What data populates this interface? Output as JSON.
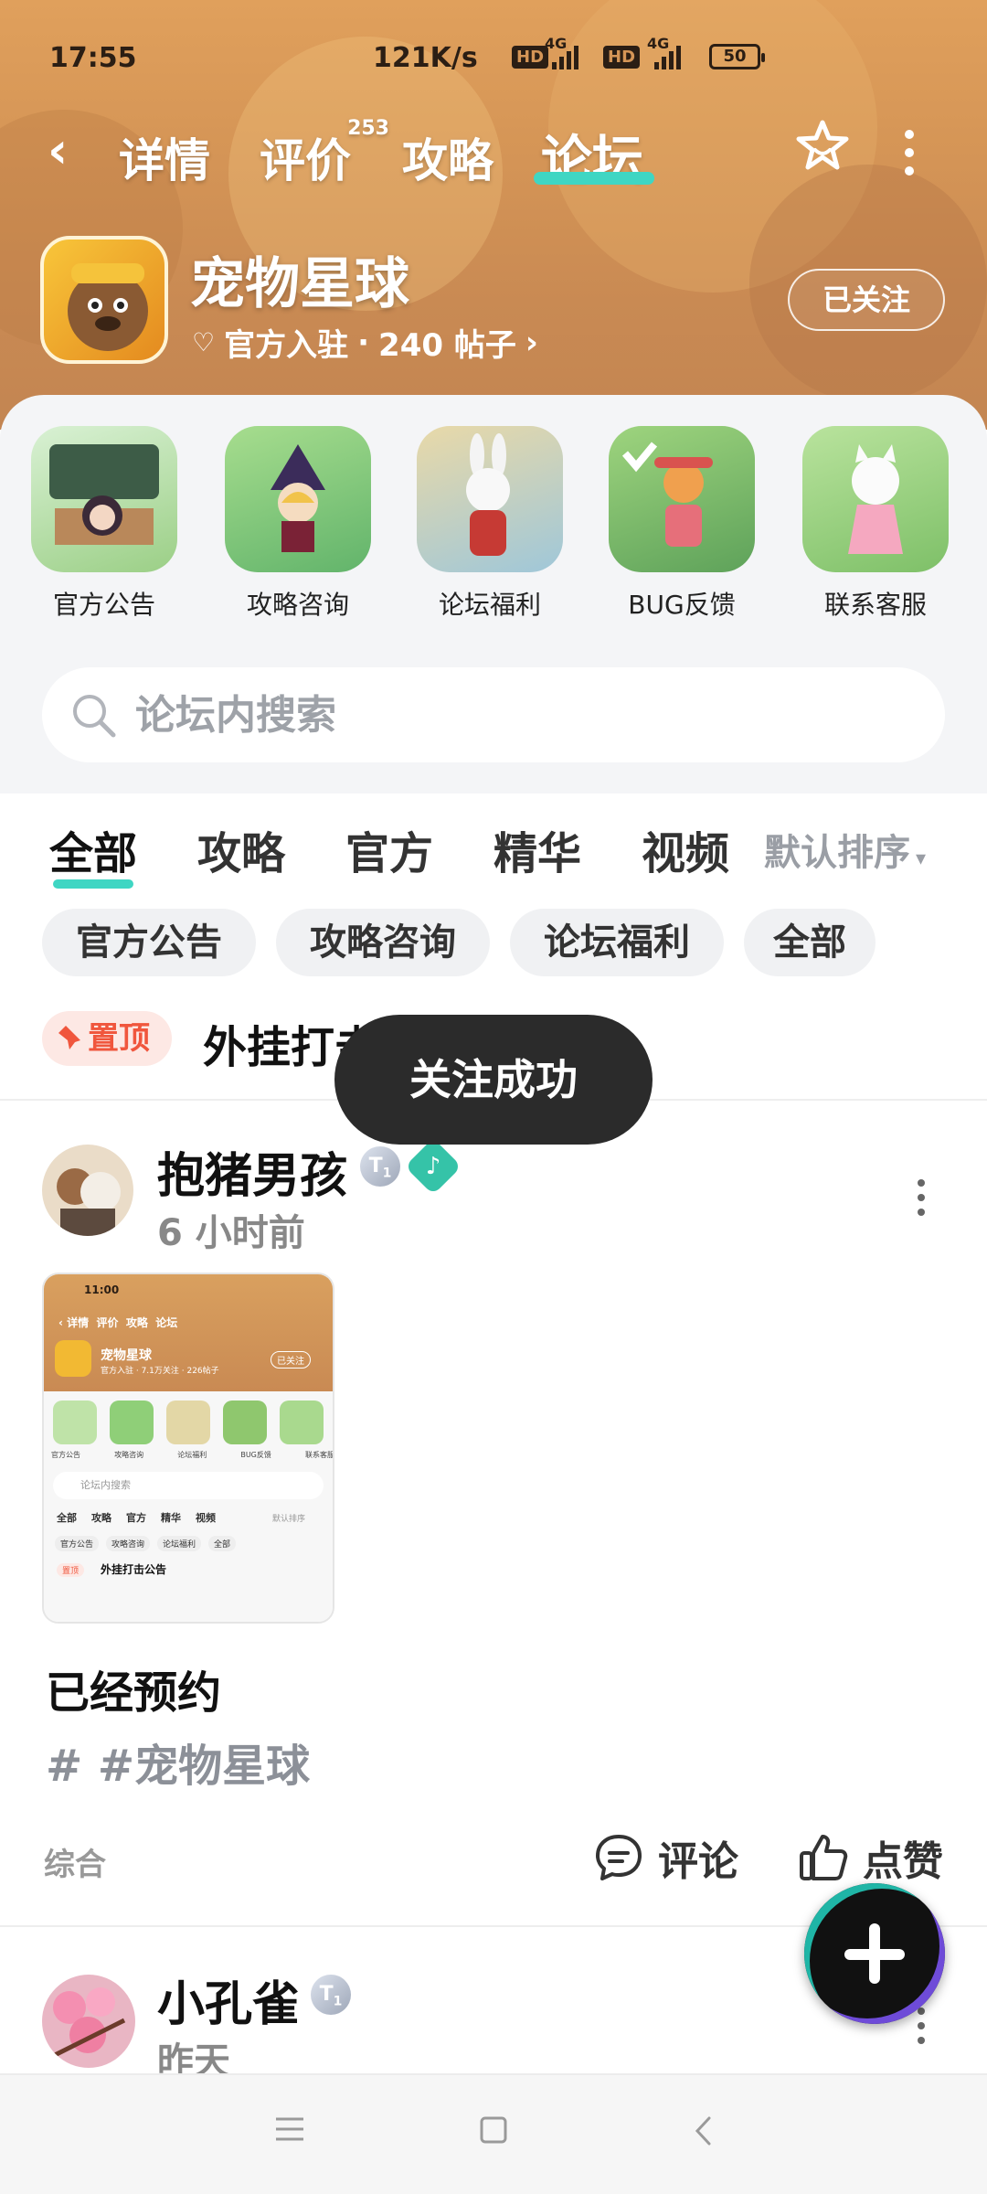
{
  "status_bar": {
    "time": "17:55",
    "speed": "121K/s",
    "battery": "50",
    "hd1": "HD",
    "hd2": "HD",
    "net1": "4G",
    "net2": "4G"
  },
  "nav": {
    "tabs": [
      {
        "label": "详情"
      },
      {
        "label": "评价",
        "count": "253"
      },
      {
        "label": "攻略"
      },
      {
        "label": "论坛",
        "active": true
      }
    ]
  },
  "app": {
    "name": "宠物星球",
    "meta_official": "官方入驻",
    "meta_dot": "·",
    "meta_posts": "240 帖子",
    "follow_label": "已关注"
  },
  "quick_links": [
    {
      "label": "官方公告"
    },
    {
      "label": "攻略咨询"
    },
    {
      "label": "论坛福利"
    },
    {
      "label": "BUG反馈"
    },
    {
      "label": "联系客服"
    }
  ],
  "search": {
    "placeholder": "论坛内搜索"
  },
  "filter_tabs": [
    {
      "label": "全部",
      "active": true
    },
    {
      "label": "攻略"
    },
    {
      "label": "官方"
    },
    {
      "label": "精华"
    },
    {
      "label": "视频"
    }
  ],
  "sort_label": "默认排序",
  "chips": [
    {
      "label": "官方公告"
    },
    {
      "label": "攻略咨询"
    },
    {
      "label": "论坛福利"
    },
    {
      "label": "全部"
    }
  ],
  "pinned": {
    "badge": "置顶",
    "title": "外挂打击公告"
  },
  "toast": "关注成功",
  "posts": [
    {
      "author": "抱猪男孩",
      "time": "6 小时前",
      "badge": "T",
      "badge_level": "1",
      "title": "已经预约",
      "tag": "# #宠物星球",
      "category": "综合",
      "comment_label": "评论",
      "like_label": "点赞",
      "thumb": {
        "time": "11:00",
        "tabs": [
          "详情",
          "评价",
          "攻略",
          "论坛"
        ],
        "app_name": "宠物星球",
        "app_meta": "官方入驻 · 7.1万关注 · 226帖子",
        "follow": "已关注",
        "links": [
          "官方公告",
          "攻略咨询",
          "论坛福利",
          "BUG反馈",
          "联系客服"
        ],
        "search": "论坛内搜索",
        "ftabs": [
          "全部",
          "攻略",
          "官方",
          "精华",
          "视频"
        ],
        "sort": "默认排序",
        "chips": [
          "官方公告",
          "攻略咨询",
          "论坛福利",
          "全部"
        ],
        "pin_badge": "置顶",
        "pin_title": "外挂打击公告"
      }
    },
    {
      "author": "小孔雀",
      "time": "昨天",
      "badge": "T",
      "badge_level": "1"
    }
  ],
  "colors": {
    "accent": "#3fd6c3",
    "pin_red": "#f0563d",
    "header": "#d59556"
  }
}
